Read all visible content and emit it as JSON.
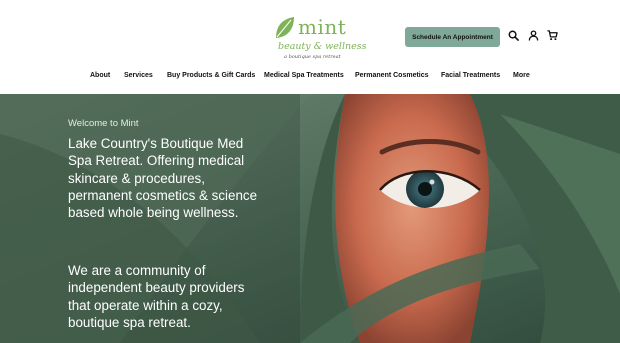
{
  "brand": {
    "name": "mint",
    "subtitle": "beauty & wellness",
    "tagline": "a boutique spa retreat",
    "leaf_icon": "leaf-icon",
    "color": "#7fb35a"
  },
  "header": {
    "cta_label": "Schedule An Appointment",
    "cta_color": "#7fa898",
    "icons": [
      "search-icon",
      "user-icon",
      "cart-icon"
    ]
  },
  "nav": {
    "items": [
      {
        "label": "About"
      },
      {
        "label": "Services"
      },
      {
        "label": "Buy Products & Gift Cards"
      },
      {
        "label": "Medical Spa Treatments"
      },
      {
        "label": "Permanent Cosmetics"
      },
      {
        "label": "Facial Treatments"
      },
      {
        "label": "More"
      }
    ]
  },
  "hero": {
    "welcome": "Welcome to Mint",
    "paragraph1": "Lake Country's Boutique Med Spa Retreat. Offering medical skincare & procedures, permanent cosmetics & science based whole being wellness.",
    "paragraph2": "We are a community of independent beauty providers that operate within a cozy, boutique spa retreat."
  }
}
